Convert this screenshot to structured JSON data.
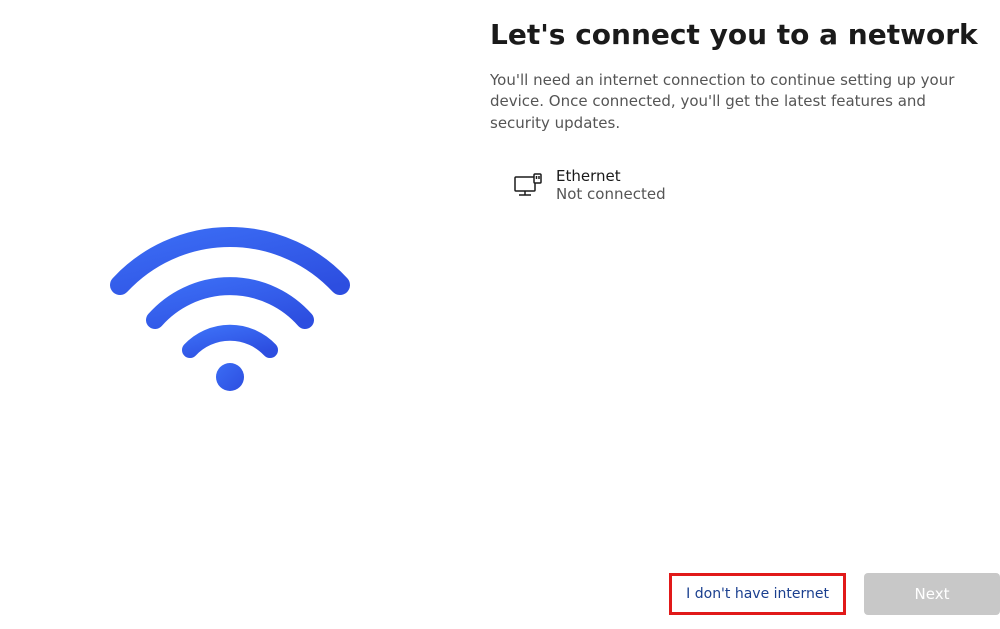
{
  "title": "Let's connect you to a network",
  "subtitle": "You'll need an internet connection to continue setting up your device. Once connected, you'll get the latest features and security updates.",
  "network": {
    "name": "Ethernet",
    "status": "Not connected"
  },
  "buttons": {
    "no_internet": "I don't have internet",
    "next": "Next"
  }
}
